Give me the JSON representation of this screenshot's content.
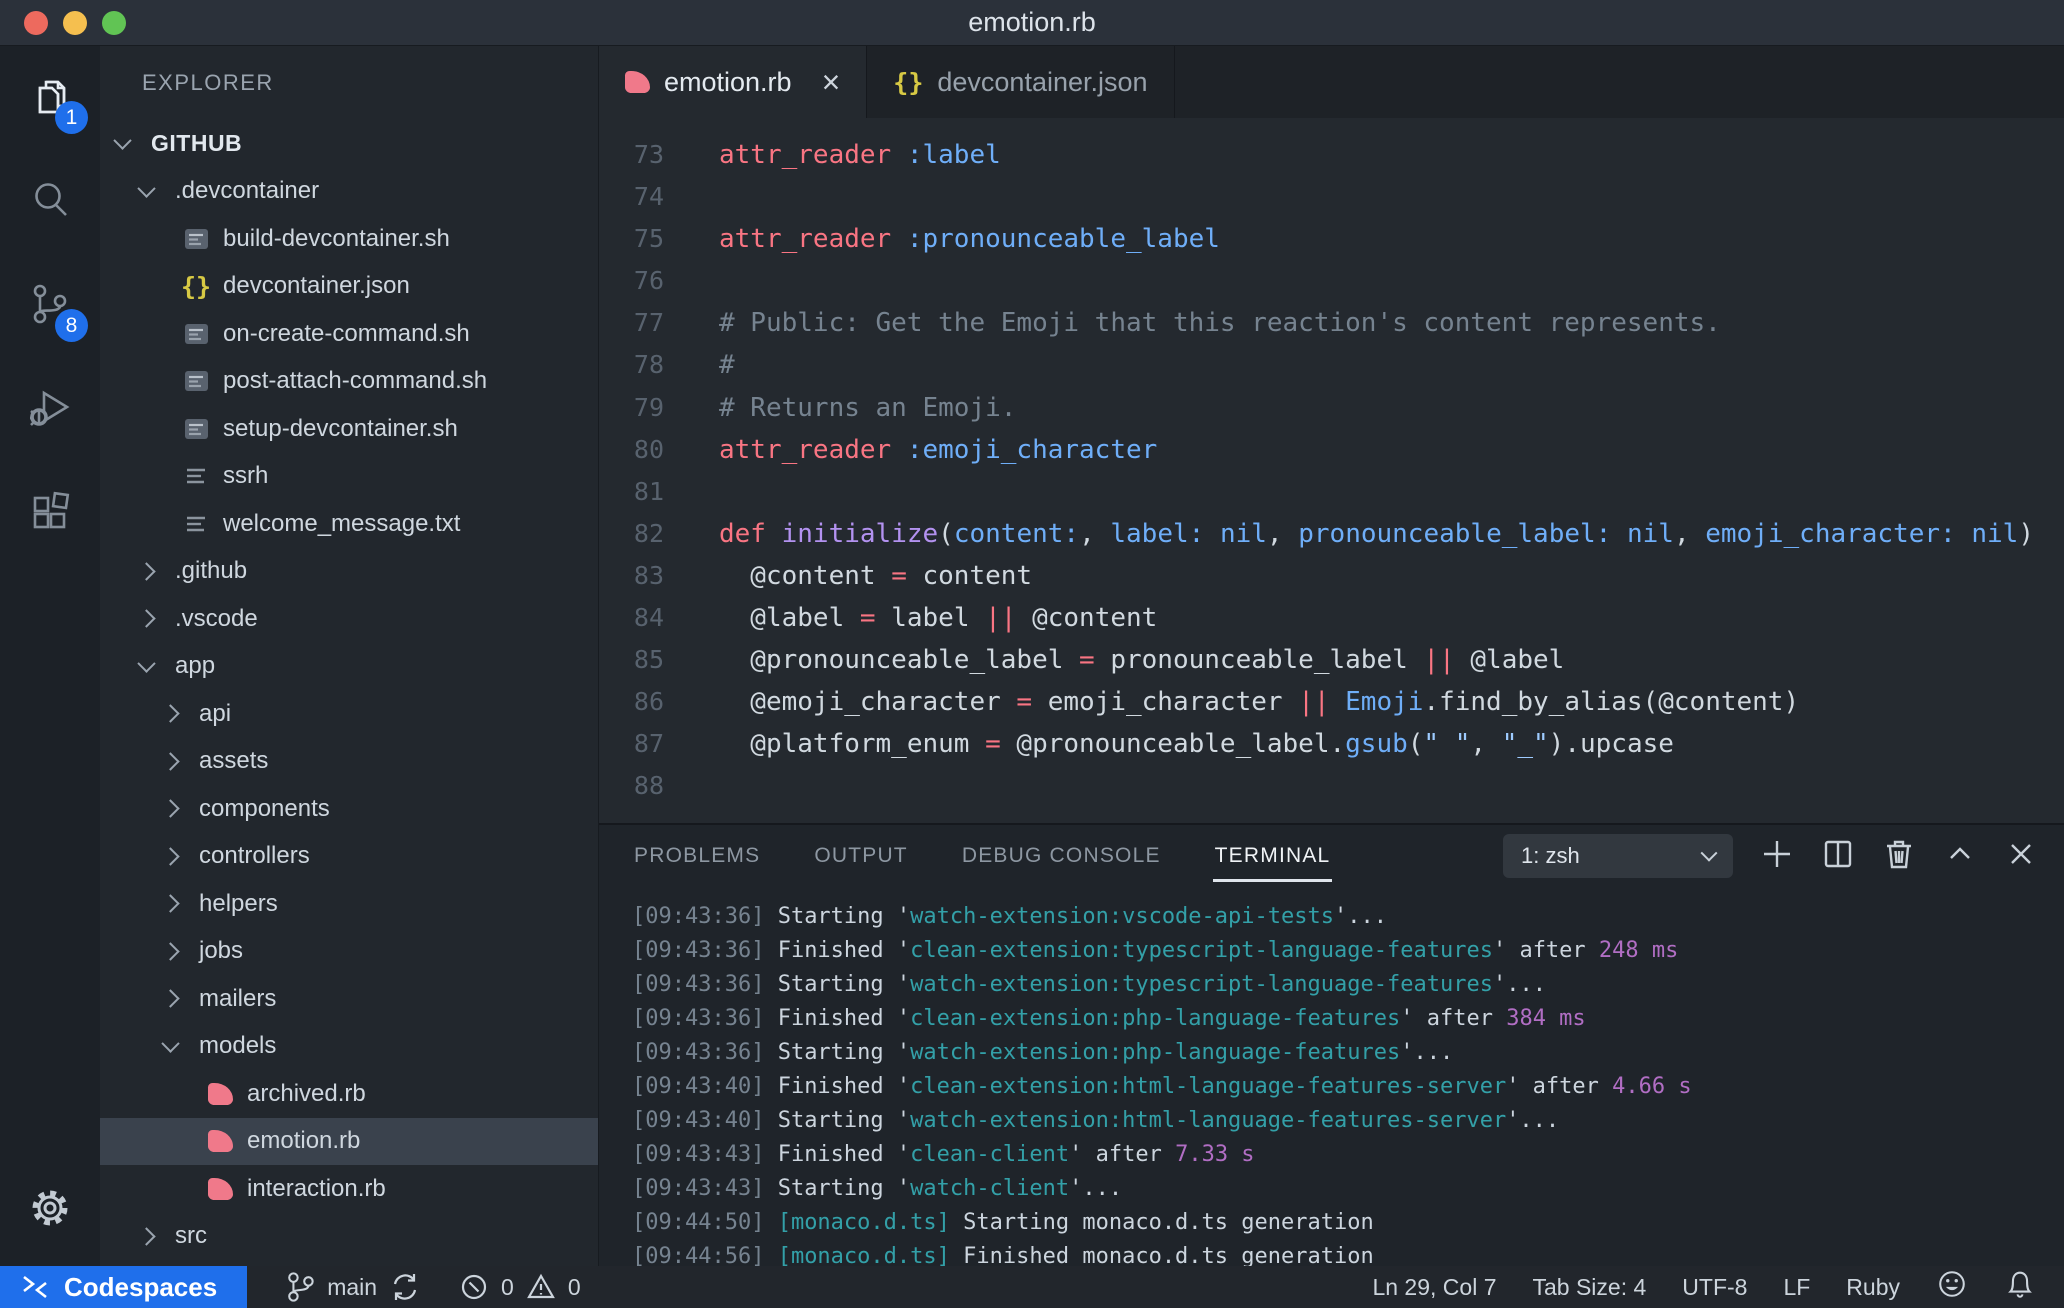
{
  "window": {
    "title": "emotion.rb"
  },
  "colors": {
    "accent_blue": "#1f6feb",
    "ruby_pink": "#f0798a",
    "json_yellow": "#d7c944",
    "keyword_pink": "#f97583",
    "function_purple": "#b392f0",
    "symbol_blue": "#6faef8",
    "string_blue": "#9ecbff",
    "comment_gray": "#768390",
    "terminal_cyan": "#33a0a8",
    "terminal_magenta": "#b16ec4"
  },
  "activity_bar": {
    "items": [
      {
        "id": "explorer",
        "icon": "files-icon",
        "badge": "1",
        "active": true
      },
      {
        "id": "search",
        "icon": "search-icon",
        "badge": null,
        "active": false
      },
      {
        "id": "source-control",
        "icon": "source-control-icon",
        "badge": "8",
        "active": false
      },
      {
        "id": "run-debug",
        "icon": "run-debug-icon",
        "badge": null,
        "active": false
      },
      {
        "id": "extensions",
        "icon": "extensions-icon",
        "badge": null,
        "active": false
      }
    ],
    "settings": {
      "id": "settings",
      "icon": "gear-icon"
    }
  },
  "sidebar": {
    "header": "EXPLORER",
    "tree": [
      {
        "label": "GITHUB",
        "type": "root",
        "level": 0,
        "expanded": true
      },
      {
        "label": ".devcontainer",
        "type": "folder",
        "level": 1,
        "expanded": true
      },
      {
        "label": "build-devcontainer.sh",
        "type": "file",
        "icon": "sh",
        "level": 2
      },
      {
        "label": "devcontainer.json",
        "type": "file",
        "icon": "json",
        "level": 2
      },
      {
        "label": "on-create-command.sh",
        "type": "file",
        "icon": "sh",
        "level": 2
      },
      {
        "label": "post-attach-command.sh",
        "type": "file",
        "icon": "sh",
        "level": 2
      },
      {
        "label": "setup-devcontainer.sh",
        "type": "file",
        "icon": "sh",
        "level": 2
      },
      {
        "label": "ssrh",
        "type": "file",
        "icon": "txt",
        "level": 2
      },
      {
        "label": "welcome_message.txt",
        "type": "file",
        "icon": "txt",
        "level": 2
      },
      {
        "label": ".github",
        "type": "folder",
        "level": 1,
        "expanded": false
      },
      {
        "label": ".vscode",
        "type": "folder",
        "level": 1,
        "expanded": false
      },
      {
        "label": "app",
        "type": "folder",
        "level": 1,
        "expanded": true
      },
      {
        "label": "api",
        "type": "folder",
        "level": 2,
        "expanded": false
      },
      {
        "label": "assets",
        "type": "folder",
        "level": 2,
        "expanded": false
      },
      {
        "label": "components",
        "type": "folder",
        "level": 2,
        "expanded": false
      },
      {
        "label": "controllers",
        "type": "folder",
        "level": 2,
        "expanded": false
      },
      {
        "label": "helpers",
        "type": "folder",
        "level": 2,
        "expanded": false
      },
      {
        "label": "jobs",
        "type": "folder",
        "level": 2,
        "expanded": false
      },
      {
        "label": "mailers",
        "type": "folder",
        "level": 2,
        "expanded": false
      },
      {
        "label": "models",
        "type": "folder",
        "level": 2,
        "expanded": true
      },
      {
        "label": "archived.rb",
        "type": "file",
        "icon": "ruby",
        "level": 3
      },
      {
        "label": "emotion.rb",
        "type": "file",
        "icon": "ruby",
        "level": 3,
        "selected": true
      },
      {
        "label": "interaction.rb",
        "type": "file",
        "icon": "ruby",
        "level": 3
      },
      {
        "label": "src",
        "type": "folder",
        "level": 1,
        "expanded": false
      }
    ]
  },
  "editor": {
    "tabs": [
      {
        "label": "emotion.rb",
        "icon": "ruby",
        "active": true,
        "close_label": "×"
      },
      {
        "label": "devcontainer.json",
        "icon": "json",
        "active": false,
        "close_label": null
      }
    ],
    "lines": [
      {
        "num": "73",
        "tokens": [
          [
            "k",
            "attr_reader"
          ],
          [
            "p",
            " "
          ],
          [
            "b",
            ":label"
          ]
        ]
      },
      {
        "num": "74",
        "tokens": []
      },
      {
        "num": "75",
        "tokens": [
          [
            "k",
            "attr_reader"
          ],
          [
            "p",
            " "
          ],
          [
            "b",
            ":pronounceable_label"
          ]
        ]
      },
      {
        "num": "76",
        "tokens": []
      },
      {
        "num": "77",
        "tokens": [
          [
            "c",
            "# Public: Get the Emoji that this reaction's content represents."
          ]
        ]
      },
      {
        "num": "78",
        "tokens": [
          [
            "c",
            "#"
          ]
        ]
      },
      {
        "num": "79",
        "tokens": [
          [
            "c",
            "# Returns an Emoji."
          ]
        ]
      },
      {
        "num": "80",
        "tokens": [
          [
            "k",
            "attr_reader"
          ],
          [
            "p",
            " "
          ],
          [
            "b",
            ":emoji_character"
          ]
        ]
      },
      {
        "num": "81",
        "tokens": []
      },
      {
        "num": "82",
        "tokens": [
          [
            "k",
            "def"
          ],
          [
            "p",
            " "
          ],
          [
            "f",
            "initialize"
          ],
          [
            "p",
            "("
          ],
          [
            "b",
            "content:"
          ],
          [
            "p",
            ", "
          ],
          [
            "b",
            "label:"
          ],
          [
            "p",
            " "
          ],
          [
            "b",
            "nil"
          ],
          [
            "p",
            ", "
          ],
          [
            "b",
            "pronounceable_label:"
          ],
          [
            "p",
            " "
          ],
          [
            "b",
            "nil"
          ],
          [
            "p",
            ", "
          ],
          [
            "b",
            "emoji_character:"
          ],
          [
            "p",
            " "
          ],
          [
            "b",
            "nil"
          ],
          [
            "p",
            ")"
          ]
        ]
      },
      {
        "num": "83",
        "tokens": [
          [
            "p",
            "  @content "
          ],
          [
            "k",
            "="
          ],
          [
            "p",
            " content"
          ]
        ]
      },
      {
        "num": "84",
        "tokens": [
          [
            "p",
            "  @label "
          ],
          [
            "k",
            "="
          ],
          [
            "p",
            " label "
          ],
          [
            "k",
            "||"
          ],
          [
            "p",
            " @content"
          ]
        ]
      },
      {
        "num": "85",
        "tokens": [
          [
            "p",
            "  @pronounceable_label "
          ],
          [
            "k",
            "="
          ],
          [
            "p",
            " pronounceable_label "
          ],
          [
            "k",
            "||"
          ],
          [
            "p",
            " @label"
          ]
        ]
      },
      {
        "num": "86",
        "tokens": [
          [
            "p",
            "  @emoji_character "
          ],
          [
            "k",
            "="
          ],
          [
            "p",
            " emoji_character "
          ],
          [
            "k",
            "||"
          ],
          [
            "p",
            " "
          ],
          [
            "b",
            "Emoji"
          ],
          [
            "p",
            ".find_by_alias(@content)"
          ]
        ]
      },
      {
        "num": "87",
        "tokens": [
          [
            "p",
            "  @platform_enum "
          ],
          [
            "k",
            "="
          ],
          [
            "p",
            " @pronounceable_label."
          ],
          [
            "b",
            "gsub"
          ],
          [
            "p",
            "("
          ],
          [
            "s",
            "\" \""
          ],
          [
            "p",
            ", "
          ],
          [
            "s",
            "\"_\""
          ],
          [
            "p",
            ").upcase"
          ]
        ]
      },
      {
        "num": "88",
        "tokens": []
      }
    ]
  },
  "panel": {
    "tabs": [
      {
        "label": "PROBLEMS",
        "active": false
      },
      {
        "label": "OUTPUT",
        "active": false
      },
      {
        "label": "DEBUG CONSOLE",
        "active": false
      },
      {
        "label": "TERMINAL",
        "active": true
      }
    ],
    "terminal_selector": "1: zsh",
    "actions": [
      "plus-icon",
      "split-terminal-icon",
      "trash-icon",
      "chevron-up-icon",
      "close-icon"
    ],
    "terminal_lines": [
      [
        [
          "ts",
          "[09:43:36]"
        ],
        [
          "pl",
          " Starting '"
        ],
        [
          "cy",
          "watch-extension:vscode-api-tests"
        ],
        [
          "pl",
          "'..."
        ]
      ],
      [
        [
          "ts",
          "[09:43:36]"
        ],
        [
          "pl",
          " Finished '"
        ],
        [
          "cy",
          "clean-extension:typescript-language-features"
        ],
        [
          "pl",
          "' after "
        ],
        [
          "mg",
          "248 ms"
        ]
      ],
      [
        [
          "ts",
          "[09:43:36]"
        ],
        [
          "pl",
          " Starting '"
        ],
        [
          "cy",
          "watch-extension:typescript-language-features"
        ],
        [
          "pl",
          "'..."
        ]
      ],
      [
        [
          "ts",
          "[09:43:36]"
        ],
        [
          "pl",
          " Finished '"
        ],
        [
          "cy",
          "clean-extension:php-language-features"
        ],
        [
          "pl",
          "' after "
        ],
        [
          "mg",
          "384 ms"
        ]
      ],
      [
        [
          "ts",
          "[09:43:36]"
        ],
        [
          "pl",
          " Starting '"
        ],
        [
          "cy",
          "watch-extension:php-language-features"
        ],
        [
          "pl",
          "'..."
        ]
      ],
      [
        [
          "ts",
          "[09:43:40]"
        ],
        [
          "pl",
          " Finished '"
        ],
        [
          "cy",
          "clean-extension:html-language-features-server"
        ],
        [
          "pl",
          "' after "
        ],
        [
          "mg",
          "4.66 s"
        ]
      ],
      [
        [
          "ts",
          "[09:43:40]"
        ],
        [
          "pl",
          " Starting '"
        ],
        [
          "cy",
          "watch-extension:html-language-features-server"
        ],
        [
          "pl",
          "'..."
        ]
      ],
      [
        [
          "ts",
          "[09:43:43]"
        ],
        [
          "pl",
          " Finished '"
        ],
        [
          "cy",
          "clean-client"
        ],
        [
          "pl",
          "' after "
        ],
        [
          "mg",
          "7.33 s"
        ]
      ],
      [
        [
          "ts",
          "[09:43:43]"
        ],
        [
          "pl",
          " Starting '"
        ],
        [
          "cy",
          "watch-client"
        ],
        [
          "pl",
          "'..."
        ]
      ],
      [
        [
          "ts",
          "[09:44:50]"
        ],
        [
          "cy",
          " [monaco.d.ts]"
        ],
        [
          "pl",
          " Starting monaco.d.ts generation"
        ]
      ],
      [
        [
          "ts",
          "[09:44:56]"
        ],
        [
          "cy",
          " [monaco.d.ts]"
        ],
        [
          "pl",
          " Finished monaco.d.ts generation"
        ]
      ]
    ]
  },
  "status_bar": {
    "codespaces_label": "Codespaces",
    "branch_label": "main",
    "errors": "0",
    "warnings": "0",
    "right_items": [
      {
        "id": "cursor-position",
        "label": "Ln 29, Col 7"
      },
      {
        "id": "tab-size",
        "label": "Tab Size: 4"
      },
      {
        "id": "encoding",
        "label": "UTF-8"
      },
      {
        "id": "eol",
        "label": "LF"
      },
      {
        "id": "language-mode",
        "label": "Ruby"
      }
    ]
  }
}
